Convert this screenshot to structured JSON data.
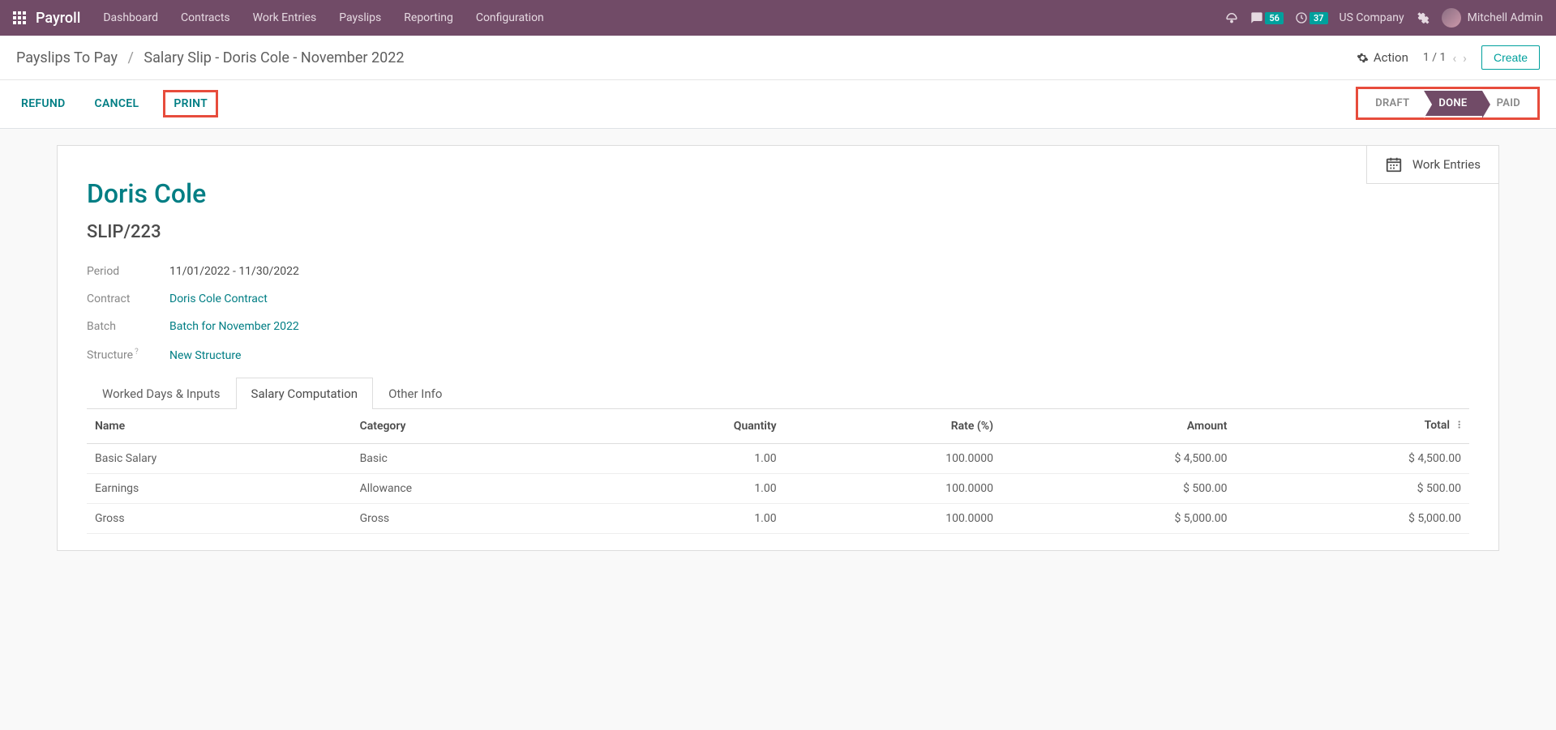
{
  "nav": {
    "brand": "Payroll",
    "menu": [
      "Dashboard",
      "Contracts",
      "Work Entries",
      "Payslips",
      "Reporting",
      "Configuration"
    ],
    "messages_count": "56",
    "activities_count": "37",
    "company": "US Company",
    "user": "Mitchell Admin"
  },
  "breadcrumb": {
    "parent": "Payslips To Pay",
    "current": "Salary Slip - Doris Cole - November 2022",
    "action_label": "Action",
    "pager": "1 / 1",
    "create": "Create"
  },
  "actions": {
    "refund": "REFUND",
    "cancel": "CANCEL",
    "print": "PRINT"
  },
  "status": {
    "draft": "DRAFT",
    "done": "DONE",
    "paid": "PAID"
  },
  "sheet": {
    "work_entries": "Work Entries",
    "employee": "Doris Cole",
    "slip": "SLIP/223",
    "fields": {
      "period_label": "Period",
      "period_value": "11/01/2022 - 11/30/2022",
      "contract_label": "Contract",
      "contract_value": "Doris Cole Contract",
      "batch_label": "Batch",
      "batch_value": "Batch for November 2022",
      "structure_label": "Structure",
      "structure_value": "New Structure"
    },
    "tabs": [
      "Worked Days & Inputs",
      "Salary Computation",
      "Other Info"
    ],
    "table": {
      "headers": {
        "name": "Name",
        "category": "Category",
        "quantity": "Quantity",
        "rate": "Rate (%)",
        "amount": "Amount",
        "total": "Total"
      },
      "rows": [
        {
          "name": "Basic Salary",
          "category": "Basic",
          "quantity": "1.00",
          "rate": "100.0000",
          "amount": "$ 4,500.00",
          "total": "$ 4,500.00"
        },
        {
          "name": "Earnings",
          "category": "Allowance",
          "quantity": "1.00",
          "rate": "100.0000",
          "amount": "$ 500.00",
          "total": "$ 500.00"
        },
        {
          "name": "Gross",
          "category": "Gross",
          "quantity": "1.00",
          "rate": "100.0000",
          "amount": "$ 5,000.00",
          "total": "$ 5,000.00"
        }
      ]
    }
  }
}
